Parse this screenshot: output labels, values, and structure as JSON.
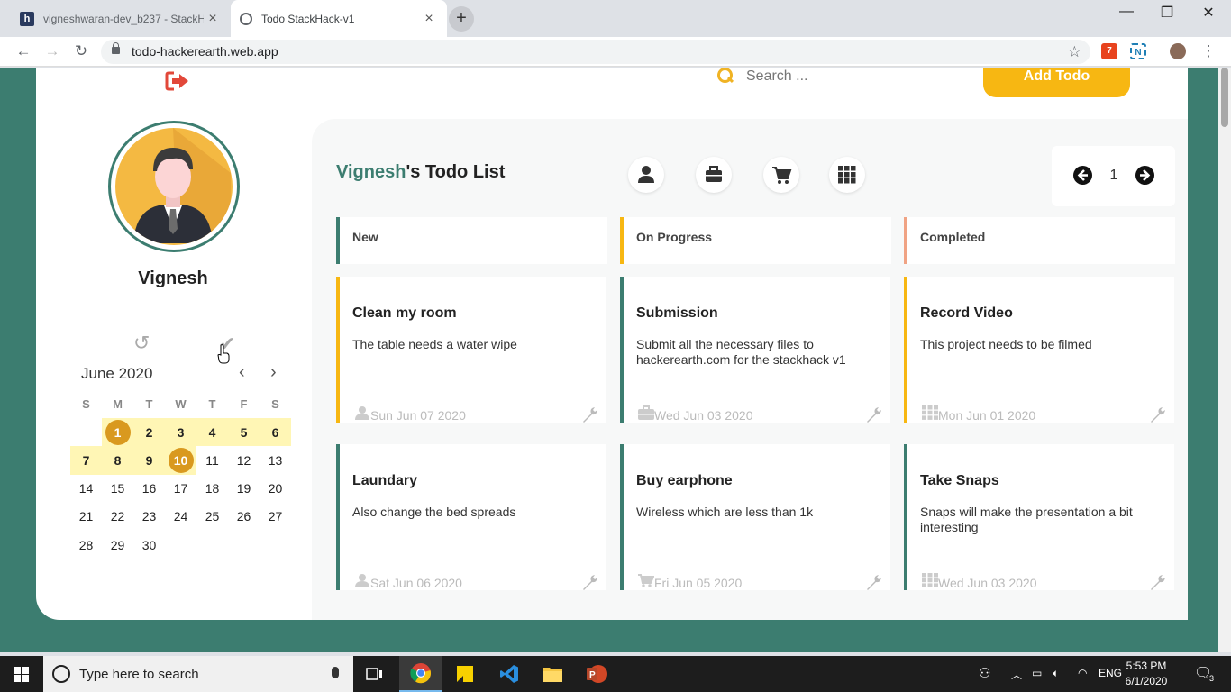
{
  "browser": {
    "tabs": [
      {
        "label": "vigneshwaran-dev_b237 - StackH",
        "favicon": "h"
      },
      {
        "label": "Todo StackHack-v1"
      }
    ],
    "url": "todo-hackerearth.web.app"
  },
  "header": {
    "search_placeholder": "Search ...",
    "add_label": "Add Todo"
  },
  "user": {
    "name": "Vignesh"
  },
  "calendar": {
    "title": "June 2020",
    "dows": [
      "S",
      "M",
      "T",
      "W",
      "T",
      "F",
      "S"
    ],
    "weeks": [
      [
        "",
        "1",
        "2",
        "3",
        "4",
        "5",
        "6"
      ],
      [
        "7",
        "8",
        "9",
        "10",
        "11",
        "12",
        "13"
      ],
      [
        "14",
        "15",
        "16",
        "17",
        "18",
        "19",
        "20"
      ],
      [
        "21",
        "22",
        "23",
        "24",
        "25",
        "26",
        "27"
      ],
      [
        "28",
        "29",
        "30",
        "",
        "",
        "",
        ""
      ]
    ]
  },
  "list": {
    "owner": "Vignesh",
    "suffix": "'s Todo List",
    "page": "1"
  },
  "columns": [
    {
      "label": "New",
      "color": "#3c7d70"
    },
    {
      "label": "On Progress",
      "color": "#f7b712"
    },
    {
      "label": "Completed",
      "color": "#f0a384"
    }
  ],
  "todos": [
    {
      "title": "Clean my room",
      "desc": "The table needs a water wipe",
      "date": "Sun Jun 07 2020",
      "icon": "user-icon",
      "color": "#f7b712"
    },
    {
      "title": "Submission",
      "desc": "Submit all the necessary files to hackerearth.com for the stackhack v1",
      "date": "Wed Jun 03 2020",
      "icon": "briefcase-icon",
      "color": "#3c7d70"
    },
    {
      "title": "Record Video",
      "desc": "This project needs to be filmed",
      "date": "Mon Jun 01 2020",
      "icon": "grid-icon",
      "color": "#f7b712"
    },
    {
      "title": "Laundary",
      "desc": "Also change the bed spreads",
      "date": "Sat Jun 06 2020",
      "icon": "user-icon",
      "color": "#3c7d70"
    },
    {
      "title": "Buy earphone",
      "desc": "Wireless which are less than 1k",
      "date": "Fri Jun 05 2020",
      "icon": "cart-icon",
      "color": "#3c7d70"
    },
    {
      "title": "Take Snaps",
      "desc": "Snaps will make the presentation a bit interesting",
      "date": "Wed Jun 03 2020",
      "icon": "grid-icon",
      "color": "#3c7d70"
    }
  ],
  "taskbar": {
    "search_placeholder": "Type here to search",
    "lang": "ENG",
    "time": "5:53 PM",
    "date": "6/1/2020",
    "notifications": "3"
  }
}
